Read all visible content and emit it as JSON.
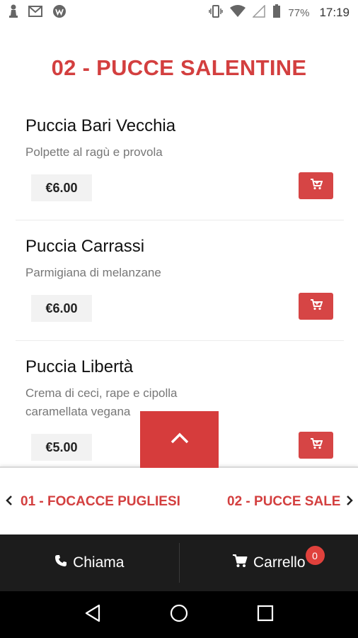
{
  "status_bar": {
    "battery_percent": "77%",
    "time": "17:19"
  },
  "category": {
    "title": "02 - PUCCE SALENTINE"
  },
  "items": [
    {
      "name": "Puccia Bari Vecchia",
      "description": "Polpette al ragù e provola",
      "price": "€6.00"
    },
    {
      "name": "Puccia Carrassi",
      "description": "Parmigiana di melanzane",
      "price": "€6.00"
    },
    {
      "name": "Puccia Libertà",
      "description": "Crema di ceci, rape e cipolla caramellata vegana",
      "price": "€5.00"
    }
  ],
  "category_tabs": [
    {
      "label": "01 - FOCACCE PUGLIESI"
    },
    {
      "label": "02 - PUCCE SALE"
    }
  ],
  "bottom_bar": {
    "call_label": "Chiama",
    "cart_label": "Carrello",
    "cart_count": "0"
  },
  "colors": {
    "accent": "#d33f3f",
    "bottom_bar_bg": "#1c1c1c",
    "price_bg": "#f2f2f2"
  },
  "icons": {
    "status_left": [
      "chess-pawn-icon",
      "gmail-icon",
      "w-app-icon"
    ],
    "status_right": [
      "vibrate-icon",
      "wifi-icon",
      "signal-icon",
      "battery-icon"
    ],
    "cart": "cart-icon",
    "scroll_top": "chevron-up-icon",
    "call": "phone-icon",
    "nav": [
      "back-icon",
      "home-icon",
      "recents-icon"
    ]
  }
}
